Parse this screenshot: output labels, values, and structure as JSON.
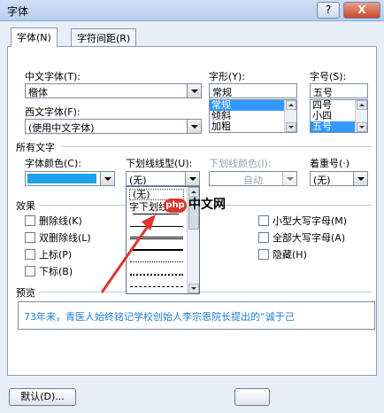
{
  "window": {
    "title": "字体",
    "help": "?",
    "close": "X"
  },
  "tabs": [
    "字体(N)",
    "字符间距(R)"
  ],
  "labels": {
    "cn_font": "中文字体(T):",
    "style": "字形(Y):",
    "size": "字号(S):",
    "west_font": "西文字体(F):",
    "all_text": "所有文字",
    "font_color": "字体颜色(C):",
    "underline_type": "下划线线型(U):",
    "underline_color": "下划线颜色(I):",
    "emphasis": "着重号(·)",
    "effects": "效果",
    "preview": "预览"
  },
  "fields": {
    "cn_font": "楷体",
    "west_font": "(使用中文字体)",
    "style": "常规",
    "size": "五号",
    "underline_type": "(无)",
    "underline_color": "自动",
    "emphasis": "(无)",
    "font_color_hex": "#1aa3e8"
  },
  "style_list": [
    {
      "label": "常规",
      "selected": true
    },
    {
      "label": "倾斜",
      "selected": false
    },
    {
      "label": "加粗",
      "selected": false
    }
  ],
  "size_list": [
    {
      "label": "四号",
      "selected": false
    },
    {
      "label": "小四",
      "selected": false
    },
    {
      "label": "五号",
      "selected": true
    }
  ],
  "underline_dropdown": [
    "(无)",
    "字下划线"
  ],
  "effects_left": [
    "删除线(K)",
    "双删除线(L)",
    "上标(P)",
    "下标(B)"
  ],
  "effects_right": [
    "小型大写字母(M)",
    "全部大写字母(A)",
    "隐藏(H)"
  ],
  "preview_text": "73年来，青医人始终铭记学校创始人李宗恩院长提出的“诚于己",
  "buttons": {
    "default": "默认(D)..."
  },
  "watermark": {
    "logo": "php",
    "text": "中文网"
  }
}
